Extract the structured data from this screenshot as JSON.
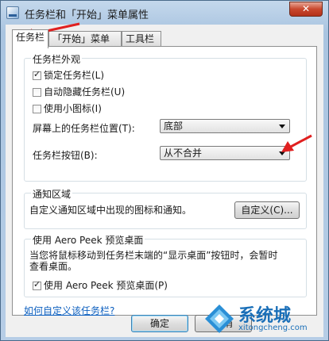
{
  "window": {
    "title": "任务栏和「开始」菜单属性",
    "close_label": "✕"
  },
  "tabs": [
    {
      "label": "任务栏",
      "active": true
    },
    {
      "label": "「开始」菜单",
      "active": false
    },
    {
      "label": "工具栏",
      "active": false
    }
  ],
  "appearance": {
    "group_label": "任务栏外观",
    "lock_taskbar": {
      "label": "锁定任务栏(L)",
      "checked": true
    },
    "auto_hide": {
      "label": "自动隐藏任务栏(U)",
      "checked": false
    },
    "small_icons": {
      "label": "使用小图标(I)",
      "checked": false
    },
    "position_label": "屏幕上的任务栏位置(T):",
    "position_value": "底部",
    "buttons_label": "任务栏按钮(B):",
    "buttons_value": "从不合并"
  },
  "notification": {
    "group_label": "通知区域",
    "description": "自定义通知区域中出现的图标和通知。",
    "customize_button": "自定义(C)..."
  },
  "aero_peek": {
    "group_label": "使用 Aero Peek 预览桌面",
    "description_line1": "当您将鼠标移动到任务栏末端的“显示桌面”按钮时，会暂时",
    "description_line2": "查看桌面。",
    "checkbox": {
      "label": "使用 Aero Peek 预览桌面(P)",
      "checked": true
    }
  },
  "help_link": "如何自定义该任务栏?",
  "footer": {
    "ok_button": "确定",
    "cancel_button": "取消"
  },
  "watermark": {
    "brand": "系统城",
    "url": "xitongcheng.com"
  },
  "colors": {
    "annotation_arrow": "#e02020",
    "link": "#0c5fbf"
  }
}
